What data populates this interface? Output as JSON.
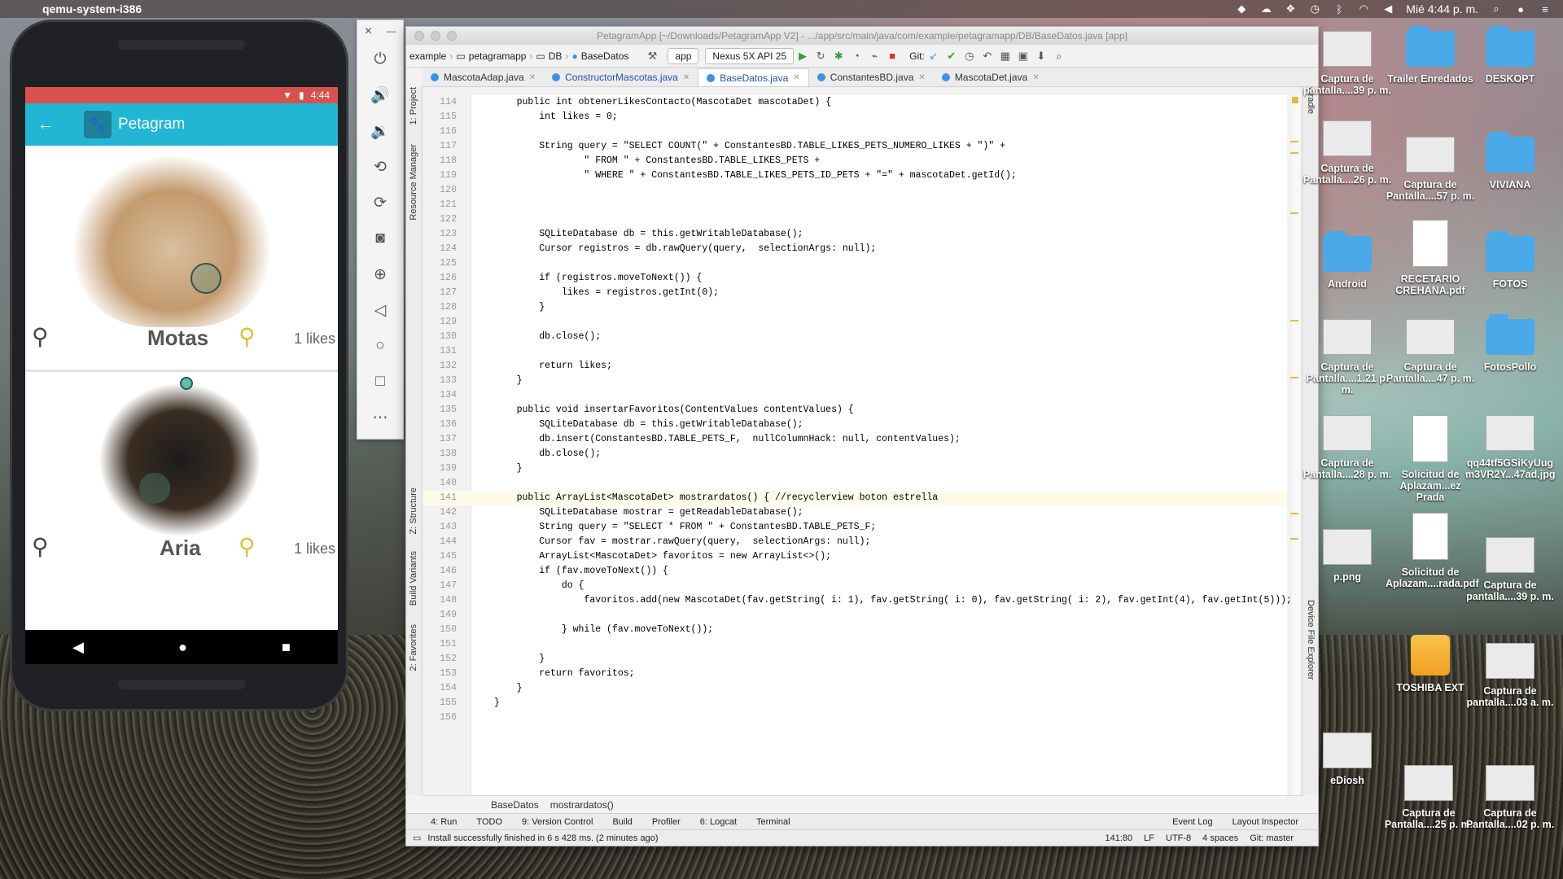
{
  "menubar": {
    "app_name": "qemu-system-i386",
    "clock": "Mié 4:44 p. m."
  },
  "phone": {
    "status_time": "4:44",
    "app_title": "Petagram",
    "pets": [
      {
        "name": "Motas",
        "likes": "1 likes"
      },
      {
        "name": "Aria",
        "likes": "1 likes"
      }
    ]
  },
  "ide": {
    "window_title": "PetagramApp [~/Downloads/PetagramApp V2] - .../app/src/main/java/com/example/petagramapp/DB/BaseDatos.java [app]",
    "breadcrumbs": [
      "example",
      "petagramapp",
      "DB",
      "BaseDatos"
    ],
    "run_config": "app",
    "device": "Nexus 5X API 25",
    "git_label": "Git:",
    "tabs": [
      "MascotaAdap.java",
      "ConstructorMascotas.java",
      "BaseDatos.java",
      "ConstantesBD.java",
      "MascotaDet.java"
    ],
    "left_tools": [
      "1: Project",
      "Resource Manager",
      "Z: Structure",
      "Build Variants",
      "2: Favorites"
    ],
    "right_tools": [
      "Gradle",
      "Device File Explorer"
    ],
    "code_breadcrumb": [
      "BaseDatos",
      "mostrardatos()"
    ],
    "bottom_tools": [
      "4: Run",
      "TODO",
      "9: Version Control",
      "Build",
      "Profiler",
      "6: Logcat",
      "Terminal",
      "Event Log",
      "Layout Inspector"
    ],
    "status_message": "Install successfully finished in 6 s 428 ms. (2 minutes ago)",
    "status_right": [
      "141:80",
      "LF",
      "UTF-8",
      "4 spaces",
      "Git: master"
    ],
    "code_lines": [
      {
        "n": "114",
        "t": "    public int obtenerLikesContacto(MascotaDet mascotaDet) {"
      },
      {
        "n": "115",
        "t": "        int likes = 0;"
      },
      {
        "n": "116",
        "t": ""
      },
      {
        "n": "117",
        "t": "        String query = \"SELECT COUNT(\" + ConstantesBD.TABLE_LIKES_PETS_NUMERO_LIKES + \")\" +"
      },
      {
        "n": "118",
        "t": "                \" FROM \" + ConstantesBD.TABLE_LIKES_PETS +"
      },
      {
        "n": "119",
        "t": "                \" WHERE \" + ConstantesBD.TABLE_LIKES_PETS_ID_PETS + \"=\" + mascotaDet.getId();"
      },
      {
        "n": "120",
        "t": ""
      },
      {
        "n": "121",
        "t": ""
      },
      {
        "n": "122",
        "t": ""
      },
      {
        "n": "123",
        "t": "        SQLiteDatabase db = this.getWritableDatabase();"
      },
      {
        "n": "124",
        "t": "        Cursor registros = db.rawQuery(query,  selectionArgs: null);"
      },
      {
        "n": "125",
        "t": ""
      },
      {
        "n": "126",
        "t": "        if (registros.moveToNext()) {"
      },
      {
        "n": "127",
        "t": "            likes = registros.getInt(0);"
      },
      {
        "n": "128",
        "t": "        }"
      },
      {
        "n": "129",
        "t": ""
      },
      {
        "n": "130",
        "t": "        db.close();"
      },
      {
        "n": "131",
        "t": ""
      },
      {
        "n": "132",
        "t": "        return likes;"
      },
      {
        "n": "133",
        "t": "    }"
      },
      {
        "n": "134",
        "t": ""
      },
      {
        "n": "135",
        "t": "    public void insertarFavoritos(ContentValues contentValues) {"
      },
      {
        "n": "136",
        "t": "        SQLiteDatabase db = this.getWritableDatabase();"
      },
      {
        "n": "137",
        "t": "        db.insert(ConstantesBD.TABLE_PETS_F,  nullColumnHack: null, contentValues);"
      },
      {
        "n": "138",
        "t": "        db.close();"
      },
      {
        "n": "139",
        "t": "    }"
      },
      {
        "n": "140",
        "t": ""
      },
      {
        "n": "141",
        "t": "    public ArrayList<MascotaDet> mostrardatos() { //recyclerview boton estrella"
      },
      {
        "n": "142",
        "t": "        SQLiteDatabase mostrar = getReadableDatabase();"
      },
      {
        "n": "143",
        "t": "        String query = \"SELECT * FROM \" + ConstantesBD.TABLE_PETS_F;"
      },
      {
        "n": "144",
        "t": "        Cursor fav = mostrar.rawQuery(query,  selectionArgs: null);"
      },
      {
        "n": "145",
        "t": "        ArrayList<MascotaDet> favoritos = new ArrayList<>();"
      },
      {
        "n": "146",
        "t": "        if (fav.moveToNext()) {"
      },
      {
        "n": "147",
        "t": "            do {"
      },
      {
        "n": "148",
        "t": "                favoritos.add(new MascotaDet(fav.getString( i: 1), fav.getString( i: 0), fav.getString( i: 2), fav.getInt(4), fav.getInt(5)));"
      },
      {
        "n": "149",
        "t": ""
      },
      {
        "n": "150",
        "t": "            } while (fav.moveToNext());"
      },
      {
        "n": "151",
        "t": ""
      },
      {
        "n": "152",
        "t": "        }"
      },
      {
        "n": "153",
        "t": "        return favoritos;"
      },
      {
        "n": "154",
        "t": "    }"
      },
      {
        "n": "155",
        "t": "}"
      },
      {
        "n": "156",
        "t": ""
      }
    ]
  },
  "desktop": [
    {
      "label": "Captura de pantalla....39 p. m.",
      "kind": "thumb"
    },
    {
      "label": "Trailer Enredados",
      "kind": "folder"
    },
    {
      "label": "DESKOPT",
      "kind": "folder"
    },
    {
      "label": "Captura de Pantalla....26 p. m.",
      "kind": "thumb"
    },
    {
      "label": "Captura de Pantalla....57 p. m.",
      "kind": "thumb"
    },
    {
      "label": "VIVIANA",
      "kind": "folder"
    },
    {
      "label": "Android",
      "kind": "folder"
    },
    {
      "label": "RECETARIO CREHANA.pdf",
      "kind": "doc"
    },
    {
      "label": "FOTOS",
      "kind": "folder"
    },
    {
      "label": "Captura de Pantalla....1.21 p. m.",
      "kind": "thumb"
    },
    {
      "label": "Captura de Pantalla....47 p. m.",
      "kind": "thumb"
    },
    {
      "label": "FotosPollo",
      "kind": "folder"
    },
    {
      "label": "Captura de Pantalla....28 p. m.",
      "kind": "thumb"
    },
    {
      "label": "Solicitud de Aplazam...ez Prada",
      "kind": "doc"
    },
    {
      "label": "qq44tf5GSiKyUug m3VR2Y...47ad.jpg",
      "kind": "thumb"
    },
    {
      "label": "p.png",
      "kind": "thumb"
    },
    {
      "label": "Solicitud de Aplazam....rada.pdf",
      "kind": "doc"
    },
    {
      "label": "Captura de pantalla....39 p. m.",
      "kind": "thumb"
    },
    {
      "label": "TOSHIBA EXT",
      "kind": "drive"
    },
    {
      "label": "Captura de pantalla....03 a. m.",
      "kind": "thumb"
    },
    {
      "label": "eDiosh",
      "kind": "thumb"
    },
    {
      "label": "Captura de Pantalla....25 p. m.",
      "kind": "thumb"
    },
    {
      "label": "Captura de Pantalla....02 p. m.",
      "kind": "thumb"
    }
  ]
}
